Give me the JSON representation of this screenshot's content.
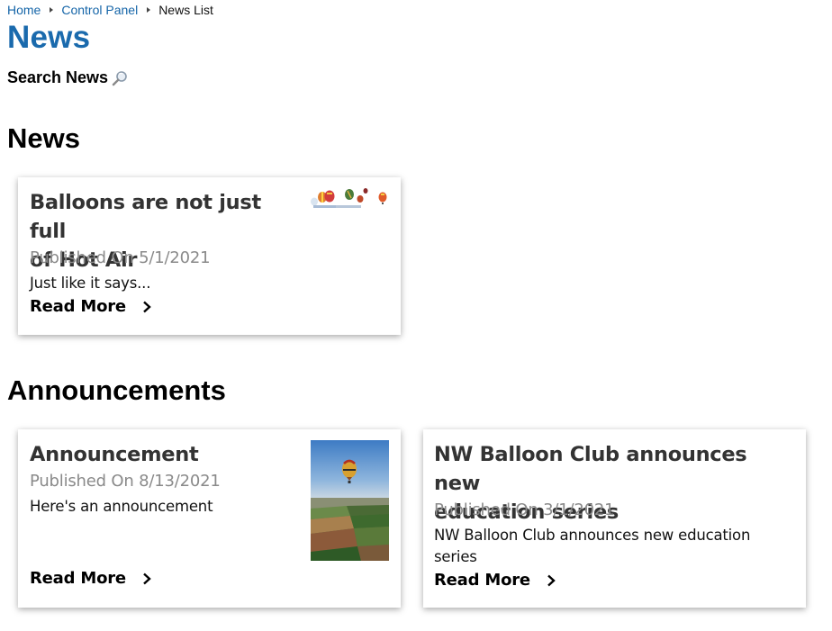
{
  "breadcrumb": {
    "items": [
      "Home",
      "Control Panel"
    ],
    "current": "News List"
  },
  "page": {
    "title": "News",
    "search_label": "Search News"
  },
  "sections": {
    "news": {
      "title": "News",
      "items": [
        {
          "title_line1": "Balloons are not just full",
          "title_line2": "of Hot Air",
          "date": "Published On 5/1/2021",
          "summary": "Just like it says...",
          "read_more": "Read More"
        }
      ]
    },
    "announcements": {
      "title": "Announcements",
      "items": [
        {
          "title": "Announcement",
          "date": "Published On 8/13/2021",
          "summary": "Here's an announcement",
          "read_more": "Read More"
        },
        {
          "title_line1": "NW Balloon Club announces new",
          "title_line2": "education series",
          "date": "Published On 3/1/2021",
          "summary_line1": "NW Balloon Club announces new education",
          "summary_line2": "series",
          "read_more": "Read More"
        }
      ]
    }
  },
  "colors": {
    "link": "#1565a8",
    "title": "#1a6aad",
    "date": "#8a8a8a"
  },
  "icons": [
    "chevron-right-icon",
    "magnifier-icon",
    "balloons-thumbnail",
    "balloon-landscape-thumbnail"
  ]
}
